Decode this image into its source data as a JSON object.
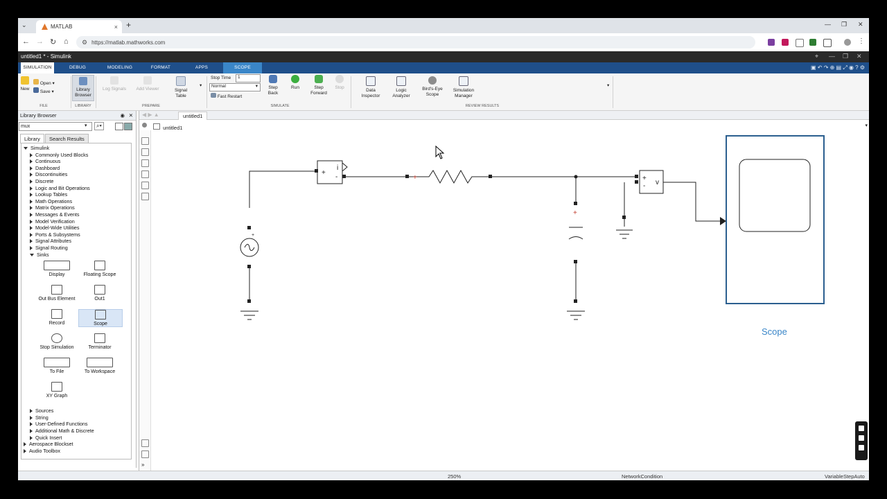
{
  "browser": {
    "tab_title": "MATLAB",
    "url": "https://matlab.mathworks.com",
    "close_glyph": "×",
    "new_tab_glyph": "+",
    "menu_glyph": "⌄",
    "window_controls": [
      "—",
      "❐",
      "✕"
    ],
    "nav_glyphs": [
      "←",
      "→",
      "↻",
      "⌂"
    ],
    "lock_glyph": "⚙",
    "extensions": [
      {
        "name": "R",
        "color": "#7b3fa0"
      },
      {
        "name": "lb",
        "color": "#c2185b"
      },
      {
        "name": "S",
        "color": "#555555"
      },
      {
        "name": "ext",
        "color": "#2e7d32"
      },
      {
        "name": "puzzle",
        "color": "#555555"
      }
    ]
  },
  "simulink": {
    "window_title": "untitled1 * - Simulink",
    "title_controls": [
      "⌖",
      "—",
      "❐",
      "✕"
    ]
  },
  "ribbon_tabs": [
    "SIMULATION",
    "DEBUG",
    "MODELING",
    "FORMAT",
    "APPS",
    "SCOPE"
  ],
  "ribbon": {
    "file": {
      "new": "New",
      "open": "Open",
      "save": "Save",
      "label": "FILE"
    },
    "library": {
      "browser": "Library Browser",
      "label": "LIBRARY"
    },
    "prepare": {
      "log_signals": "Log Signals",
      "add_viewer": "Add Viewer",
      "signal_table": "Signal Table",
      "label": "PREPARE"
    },
    "simulate": {
      "stop_time_label": "Stop Time",
      "stop_time_value": "1",
      "mode": "Normal",
      "fast_restart": "Fast Restart",
      "step_back": "Step Back",
      "run": "Run",
      "step_forward": "Step Forward",
      "stop": "Stop",
      "label": "SIMULATE"
    },
    "review": {
      "data_inspector": "Data Inspector",
      "logic_analyzer": "Logic Analyzer",
      "birds_eye": "Bird's-Eye Scope",
      "sim_manager": "Simulation Manager",
      "label": "REVIEW RESULTS"
    }
  },
  "library_browser": {
    "title": "Library Browser",
    "search_value": "mux",
    "tabs": [
      "Library",
      "Search Results"
    ],
    "tree": [
      {
        "label": "Simulink",
        "level": 0,
        "open": true
      },
      {
        "label": "Commonly Used Blocks",
        "level": 1
      },
      {
        "label": "Continuous",
        "level": 1
      },
      {
        "label": "Dashboard",
        "level": 1
      },
      {
        "label": "Discontinuities",
        "level": 1
      },
      {
        "label": "Discrete",
        "level": 1
      },
      {
        "label": "Logic and Bit Operations",
        "level": 1
      },
      {
        "label": "Lookup Tables",
        "level": 1
      },
      {
        "label": "Math Operations",
        "level": 1
      },
      {
        "label": "Matrix Operations",
        "level": 1
      },
      {
        "label": "Messages & Events",
        "level": 1
      },
      {
        "label": "Model Verification",
        "level": 1
      },
      {
        "label": "Model-Wide Utilities",
        "level": 1
      },
      {
        "label": "Ports & Subsystems",
        "level": 1
      },
      {
        "label": "Signal Attributes",
        "level": 1
      },
      {
        "label": "Signal Routing",
        "level": 1
      },
      {
        "label": "Sinks",
        "level": 1,
        "open": true
      }
    ],
    "sinks": [
      "Display",
      "Floating Scope",
      "Out Bus Element",
      "Out1",
      "Record",
      "Scope",
      "Stop Simulation",
      "Terminator",
      "To File",
      "To Workspace",
      "XY Graph"
    ],
    "tree_after": [
      {
        "label": "Sources",
        "level": 1
      },
      {
        "label": "String",
        "level": 1
      },
      {
        "label": "User-Defined Functions",
        "level": 1
      },
      {
        "label": "Additional Math & Discrete",
        "level": 1
      },
      {
        "label": "Quick Insert",
        "level": 1
      },
      {
        "label": "Aerospace Blockset",
        "level": 0
      },
      {
        "label": "Audio Toolbox",
        "level": 0
      }
    ]
  },
  "canvas": {
    "tab": "untitled1",
    "breadcrumb": "untitled1",
    "scope_label": "Scope",
    "current_sensor_label": "i",
    "voltage_sensor_label": "v"
  },
  "status_bar": {
    "zoom": "250%",
    "condition": "NetworkCondition",
    "solver": "VariableStepAuto"
  },
  "colors": {
    "ribbon_tab_bar": "#1f4f8a",
    "scope_tab": "#3a86c8",
    "scope_accent": "#3a86c8",
    "selection": "#d9e6f6"
  }
}
